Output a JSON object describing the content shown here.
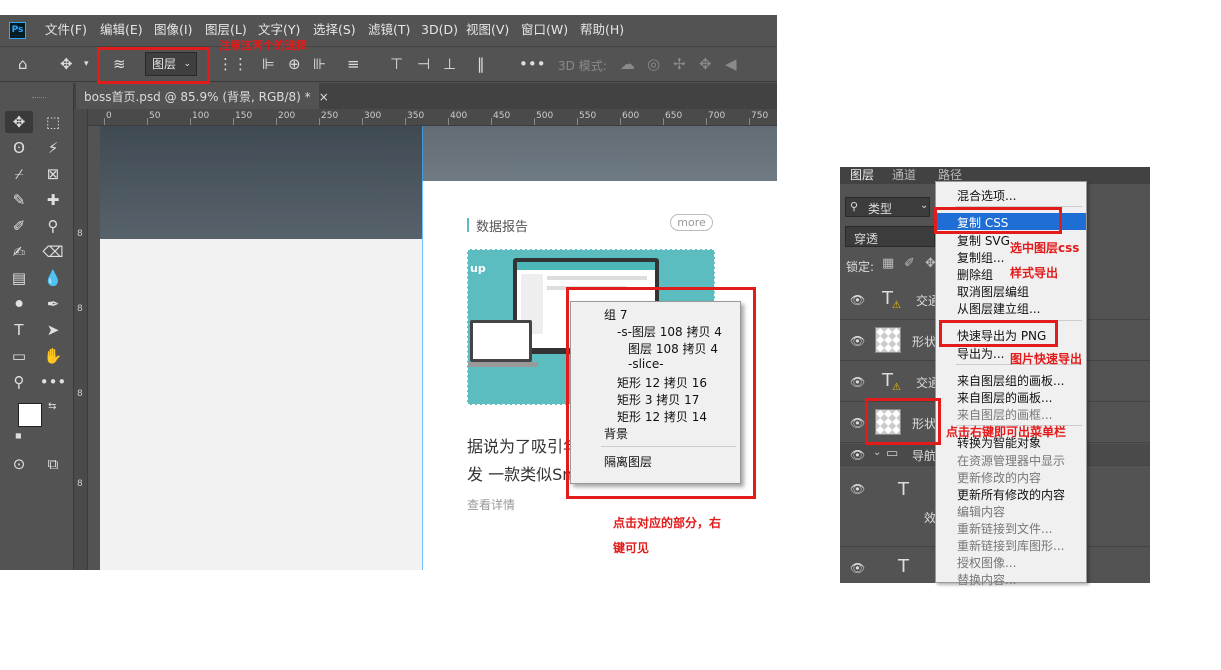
{
  "menubar": {
    "logo": "Ps",
    "items": [
      "文件(F)",
      "编辑(E)",
      "图像(I)",
      "图层(L)",
      "文字(Y)",
      "选择(S)",
      "滤镜(T)",
      "3D(D)",
      "视图(V)",
      "窗口(W)",
      "帮助(H)"
    ]
  },
  "optbar": {
    "select_value": "图层",
    "mode_3d": "3D 模式:",
    "annotation": "注意这两个的选择"
  },
  "doc_tab": {
    "title": "boss首页.psd @ 85.9% (背景, RGB/8) *",
    "close": "×"
  },
  "ruler": {
    "ticks": [
      "0",
      "50",
      "100",
      "150",
      "200",
      "250",
      "300",
      "350",
      "400",
      "450",
      "500",
      "550",
      "600",
      "650",
      "700",
      "750"
    ],
    "left_ticks": [
      "8",
      "8",
      "8",
      "8"
    ]
  },
  "card": {
    "title": "数据报告",
    "more": "more",
    "line1": "据说为了吸引年",
    "line2": "发 一款类似Snapchat",
    "read_more": "查看详情",
    "thumb_label": "up"
  },
  "context_menu": {
    "items": [
      "组 7",
      "-s-图层 108 拷贝 4",
      "图层 108 拷贝 4",
      "-slice-",
      "矩形 12 拷贝 16",
      "矩形 3 拷贝 17",
      "矩形 12 拷贝 14",
      "背景"
    ],
    "isolate": "隔离图层"
  },
  "annotations": {
    "click_tip_1": "点击对应的部分，右",
    "click_tip_2": "键可见",
    "css_tip": "选中图层css",
    "css_tip2": "样式导出",
    "png_tip": "图片快速导出",
    "right_tip": "点击右键即可出菜单栏"
  },
  "layers_panel": {
    "tabs": [
      "图层",
      "通道",
      "路径"
    ],
    "filter": "类型",
    "blend": "穿透",
    "lock": "锁定:",
    "layers": [
      "交通",
      "形状",
      "交通",
      "形状",
      "导航",
      "",
      "",
      ""
    ],
    "row_text_icon": "T",
    "effect_label": "效"
  },
  "layer_menu": {
    "items": [
      "混合选项...",
      "复制 CSS",
      "复制 SVG",
      "复制组...",
      "删除组",
      "取消图层编组",
      "从图层建立组...",
      "快速导出为 PNG",
      "导出为...",
      "来自图层组的画板...",
      "来自图层的画板...",
      "来自图层的画框...",
      "转换为智能对象",
      "在资源管理器中显示",
      "更新修改的内容",
      "更新所有修改的内容",
      "编辑内容",
      "重新链接到文件...",
      "重新链接到库图形...",
      "授权图像...",
      "替换内容..."
    ],
    "disabled": [
      11,
      13,
      14,
      16,
      17,
      18,
      19,
      20
    ],
    "highlight_index": 1
  },
  "colors": {
    "accent": "#e21b1b",
    "ps_bg": "#535353",
    "highlight": "#1e6ed6",
    "teal": "#5bbdc0"
  }
}
